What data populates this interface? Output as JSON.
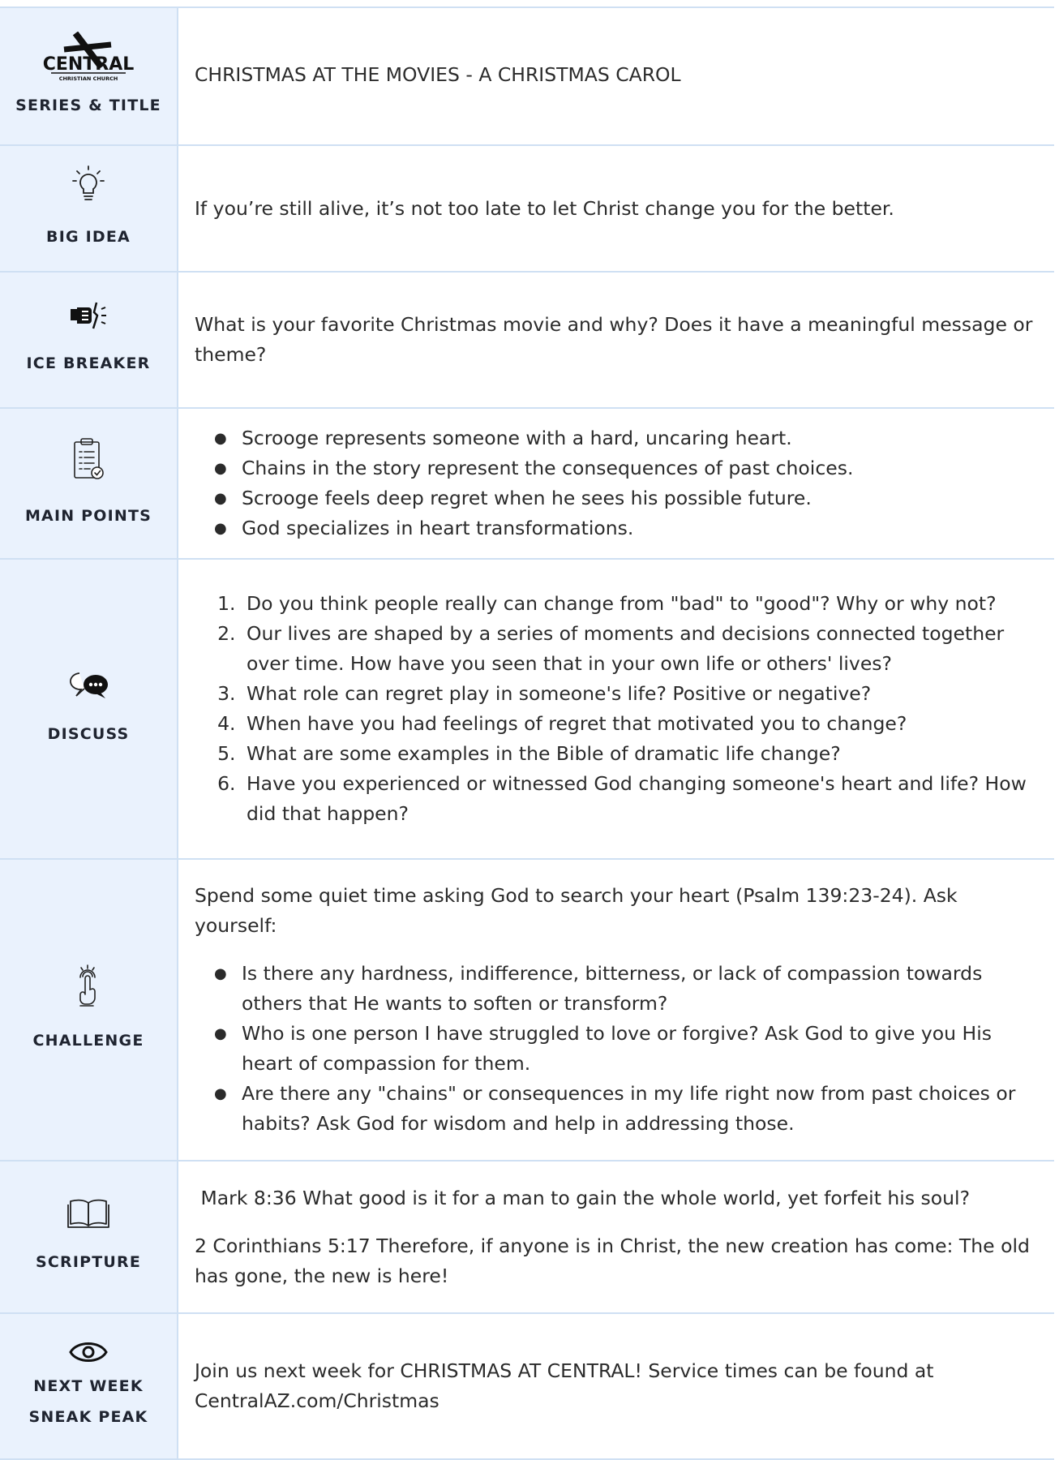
{
  "logo": {
    "word": "CENTRAL",
    "sub": "CHRISTIAN CHURCH"
  },
  "rows": {
    "series": {
      "label": "SERIES & TITLE",
      "icon": "central-church-logo",
      "text": "CHRISTMAS AT THE MOVIES - A CHRISTMAS CAROL"
    },
    "bigidea": {
      "label": "BIG IDEA",
      "icon": "lightbulb-icon",
      "text": "If you’re still alive, it’s not too late to let Christ change you for the better."
    },
    "icebreaker": {
      "label": "ICE BREAKER",
      "icon": "fist-breaking-icon",
      "text": "What is your favorite Christmas movie and why? Does it have a meaningful message or theme?"
    },
    "mainpoints": {
      "label": "MAIN POINTS",
      "icon": "clipboard-checklist-icon",
      "items": [
        "Scrooge represents someone with a hard, uncaring heart.",
        "Chains in the story represent the consequences of past choices.",
        "Scrooge feels deep regret when he sees his possible future.",
        "God specializes in heart transformations."
      ]
    },
    "discuss": {
      "label": "DISCUSS",
      "icon": "chat-bubbles-icon",
      "items": [
        "Do you think people really can change from \"bad\" to \"good\"? Why or why not?",
        "Our lives are shaped by a series of moments and decisions connected together over time. How have you seen that in your own life or others' lives?",
        "What role can regret play in someone's life? Positive or negative?",
        "When have you had feelings of regret that motivated you to change?",
        "What are some examples in the Bible of dramatic life change?",
        "Have you experienced or witnessed God changing someone's heart and life? How did that happen?"
      ]
    },
    "challenge": {
      "label": "CHALLENGE",
      "icon": "finger-tap-icon",
      "intro": "Spend some quiet time asking God to search your heart (Psalm 139:23-24). Ask yourself:",
      "items": [
        "Is there any hardness, indifference, bitterness, or lack of compassion towards others that He wants to soften or transform?",
        "Who is one person I have struggled to love or forgive? Ask God to give you His heart of compassion for them.",
        "Are there any \"chains\" or consequences in my life right now from past choices or habits? Ask God for wisdom and help in addressing those."
      ]
    },
    "scripture": {
      "label": "SCRIPTURE",
      "icon": "open-book-icon",
      "verse1": " Mark 8:36 What good is it for a man to gain the whole world, yet forfeit his soul?",
      "verse2": "2 Corinthians 5:17 Therefore, if anyone is in Christ, the new creation has come: The old has gone, the new is here!"
    },
    "nextweek": {
      "label_line1": "NEXT WEEK",
      "label_line2": "SNEAK PEAK",
      "icon": "eye-icon",
      "text": "Join us next week for CHRISTMAS AT CENTRAL! Service times can be found at CentralAZ.com/Christmas"
    }
  }
}
